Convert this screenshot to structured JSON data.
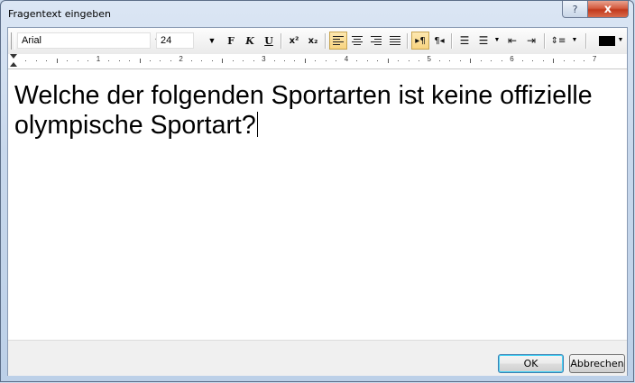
{
  "window": {
    "title": "Fragentext eingeben",
    "help_glyph": "?",
    "close_glyph": "x"
  },
  "toolbar": {
    "font_name": "Arial",
    "font_size": "24",
    "bold_label": "F",
    "italic_label": "K",
    "underline_label": "U",
    "superscript_label": "x²",
    "subscript_label": "x₂",
    "text_color": "#000000",
    "icons": [
      "align-left-icon",
      "align-center-icon",
      "align-right-icon",
      "align-justify-icon",
      "ltr-icon",
      "rtl-icon",
      "bullet-list-icon",
      "numbered-list-icon",
      "decrease-indent-icon",
      "increase-indent-icon",
      "line-spacing-icon",
      "text-color-icon"
    ]
  },
  "ruler": {
    "numbers": [
      "1",
      "2",
      "3",
      "4",
      "5",
      "6",
      "7"
    ]
  },
  "editor": {
    "text": "Welche der folgenden Sportarten ist keine offizielle olympische Sportart?"
  },
  "buttons": {
    "ok": "OK",
    "cancel": "Abbrechen"
  }
}
